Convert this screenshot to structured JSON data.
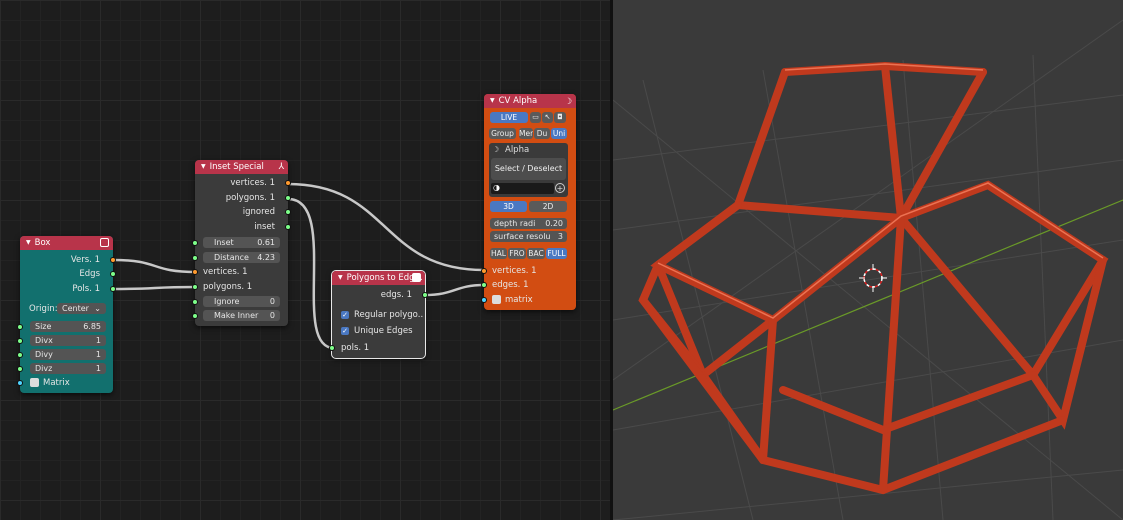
{
  "nodes": {
    "box": {
      "title": "Box",
      "outputs": [
        "Vers. 1",
        "Edgs",
        "Pols. 1"
      ],
      "origin_label": "Origin:",
      "origin_value": "Center",
      "size_label": "Size",
      "size_value": "6.85",
      "divx_label": "Divx",
      "divx_value": "1",
      "divy_label": "Divy",
      "divy_value": "1",
      "divz_label": "Divz",
      "divz_value": "1",
      "matrix_label": "Matrix"
    },
    "inset": {
      "title": "Inset Special",
      "outputs": [
        "vertices. 1",
        "polygons. 1",
        "ignored",
        "inset"
      ],
      "inset_label": "Inset",
      "inset_value": "0.61",
      "distance_label": "Distance",
      "distance_value": "4.23",
      "input_vertices": "vertices. 1",
      "input_polygons": "polygons. 1",
      "ignore_label": "Ignore",
      "ignore_value": "0",
      "make_inner_label": "Make Inner",
      "make_inner_value": "0"
    },
    "poly2edge": {
      "title": "Polygons to Edg...",
      "output": "edgs. 1",
      "opt1": "Regular polygo..",
      "opt2": "Unique Edges",
      "input": "pols. 1"
    },
    "cvalpha": {
      "title": "CV Alpha",
      "live": "LIVE",
      "group": "Group",
      "mer": "Mer",
      "du": "Du",
      "uni": "Uni",
      "alpha": "Alpha",
      "select": "Select / Deselect",
      "mode3d": "3D",
      "mode2d": "2D",
      "depth_label": "depth radi",
      "depth_value": "0.20",
      "surface_label": "surface resolu",
      "surface_value": "3",
      "hal": "HAL",
      "fro": "FRO",
      "bac": "BAC",
      "full": "FULL",
      "in_vertices": "vertices. 1",
      "in_edges": "edges. 1",
      "in_matrix": "matrix"
    }
  },
  "colors": {
    "box_header": "#b8344a",
    "box_body": "#12706e",
    "inset_header": "#b8344a",
    "inset_body": "#3b3b3b",
    "p2e_header": "#b8344a",
    "p2e_body": "#3b3b3b",
    "cv_header": "#b8344a",
    "cv_body": "#d24d12",
    "wire": "#c8c8c8",
    "frame": "#c0391d",
    "x_axis": "#8d3a3a",
    "y_axis": "#6a9a28"
  }
}
